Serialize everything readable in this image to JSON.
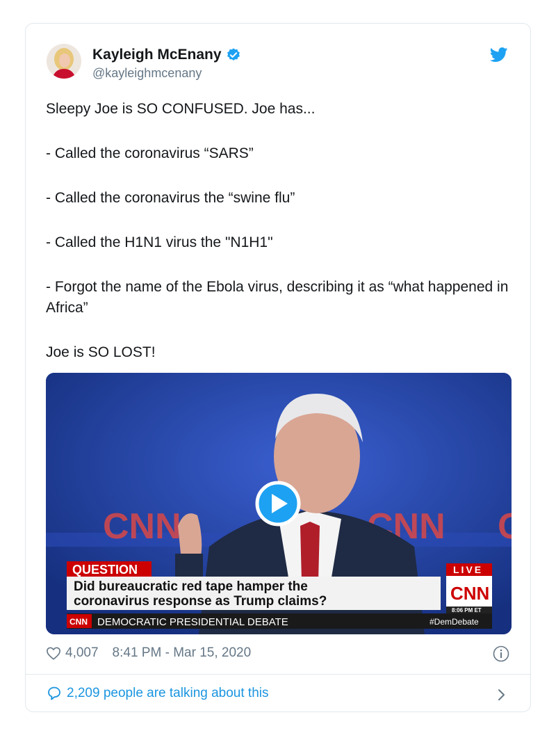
{
  "author": {
    "name": "Kayleigh McEnany",
    "handle": "@kayleighmcenany"
  },
  "tweet_lines": [
    "Sleepy Joe is SO CONFUSED. Joe has...",
    "- Called the coronavirus “SARS”",
    "- Called the coronavirus the “swine flu”",
    "- Called the H1N1 virus the \"N1H1\"",
    "- Forgot the name of the Ebola virus, describing it as “what happened in Africa”",
    "Joe is SO LOST!"
  ],
  "video": {
    "network_logo": "CNN",
    "question_label": "QUESTION",
    "question_line1": "Did bureaucratic red tape hamper the",
    "question_line2": "coronavirus response as Trump claims?",
    "live_label": "LIVE",
    "time": "8:06 PM ET",
    "ticker_logo": "CNN",
    "ticker_text": "DEMOCRATIC PRESIDENTIAL DEBATE",
    "hashtag": "#DemDebate"
  },
  "meta": {
    "likes": "4,007",
    "timestamp": "8:41 PM - Mar 15, 2020"
  },
  "footer": {
    "talking": "2,209 people are talking about this"
  },
  "colors": {
    "twitter_blue": "#1da1f2",
    "link_blue": "#1b95e0",
    "cnn_red": "#cc0000"
  }
}
